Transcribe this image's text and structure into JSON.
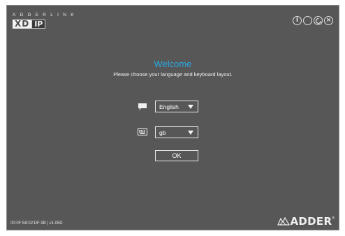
{
  "brand": {
    "top": "ADDERLINK",
    "xd": "XD",
    "ip": "IP"
  },
  "controls": {
    "info": "i",
    "close": "×",
    "icons": [
      "info-icon",
      "circle-icon",
      "refresh-icon",
      "close-icon"
    ]
  },
  "welcome": {
    "title": "Welcome",
    "subtitle": "Please choose your language and keyboard layout."
  },
  "language": {
    "icon": "speech-bubble-icon",
    "selected": "English"
  },
  "keyboard": {
    "icon": "keyboard-icon",
    "selected": "gb"
  },
  "ok_label": "OK",
  "footer": {
    "info": "00:0F:58:02:DF:3B | v1.05D",
    "logo": "ADDER",
    "reg": "®"
  },
  "colors": {
    "background": "#575757",
    "accent": "#2aa7e0",
    "text": "#f0f0f0"
  }
}
